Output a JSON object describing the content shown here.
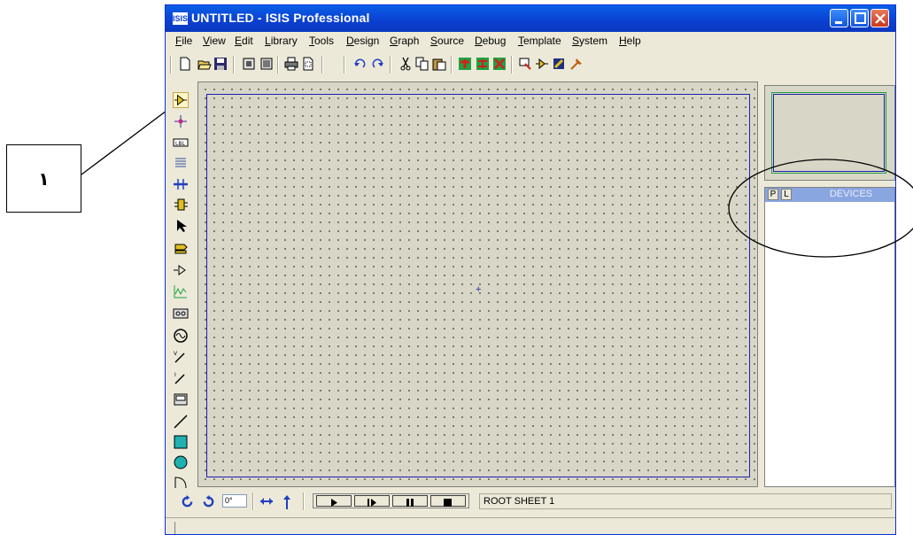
{
  "annotation": {
    "label": "١"
  },
  "window": {
    "title": "UNTITLED - ISIS Professional",
    "app_icon": "ISIS"
  },
  "menu": [
    {
      "label": "File"
    },
    {
      "label": "View"
    },
    {
      "label": "Edit"
    },
    {
      "label": "Library"
    },
    {
      "label": "Tools"
    },
    {
      "label": "Design"
    },
    {
      "label": "Graph"
    },
    {
      "label": "Source"
    },
    {
      "label": "Debug"
    },
    {
      "label": "Template"
    },
    {
      "label": "System"
    },
    {
      "label": "Help"
    }
  ],
  "toolbar_icons": [
    "new-icon",
    "open-icon",
    "save-icon",
    "import-icon",
    "export-icon",
    "print-icon",
    "print-area-icon",
    "undo-icon",
    "redo-icon",
    "cut-icon",
    "copy-icon",
    "paste-icon",
    "block-copy-icon",
    "block-move-icon",
    "block-delete-icon",
    "pick-device-icon",
    "make-device-icon",
    "package-icon",
    "decompose-icon"
  ],
  "left_tools": [
    "component-mode-icon",
    "junction-dot-icon",
    "wire-label-icon",
    "text-script-icon",
    "bus-icon",
    "subcircuit-icon",
    "selection-icon",
    "terminal-icon",
    "device-pin-icon",
    "graph-icon",
    "tape-recorder-icon",
    "generator-icon",
    "voltage-probe-icon",
    "current-probe-icon",
    "virtual-instrument-icon",
    "line-icon",
    "box-icon",
    "circle-icon",
    "arc-icon"
  ],
  "device_panel": {
    "p_label": "P",
    "l_label": "L",
    "title": "DEVICES"
  },
  "rotation": {
    "value": "0°"
  },
  "sheet": {
    "label": "ROOT SHEET 1"
  }
}
